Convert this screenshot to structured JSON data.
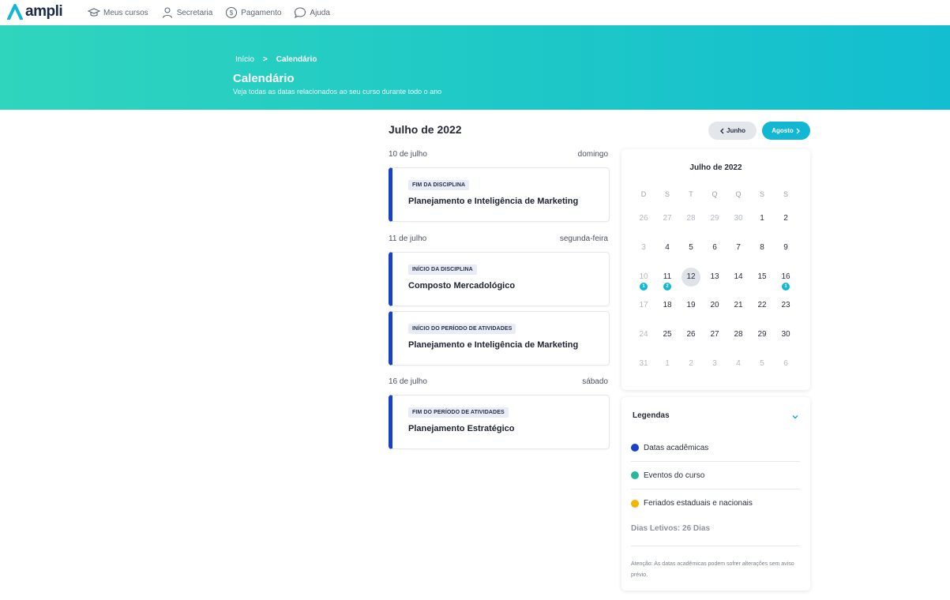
{
  "brand": {
    "name": "ampli",
    "color": "#12b7d3"
  },
  "nav": {
    "items": [
      {
        "label": "Meus cursos",
        "icon": "graduation-cap-icon"
      },
      {
        "label": "Secretaria",
        "icon": "user-icon"
      },
      {
        "label": "Pagamento",
        "icon": "dollar-circle-icon"
      },
      {
        "label": "Ajuda",
        "icon": "chat-bubble-icon"
      }
    ]
  },
  "breadcrumb": {
    "home": "Início",
    "separator": ">",
    "current": "Calendário"
  },
  "hero": {
    "title": "Calendário",
    "subtitle": "Veja todas as datas relacionados ao seu curso durante todo o ano"
  },
  "month": {
    "title": "Julho de 2022",
    "prev_label": "Junho",
    "next_label": "Agosto"
  },
  "days": [
    {
      "date": "10 de julho",
      "weekday": "domingo",
      "events": [
        {
          "tag": "FIM DA DISCIPLINA",
          "name": "Planejamento e Inteligência de Marketing"
        }
      ]
    },
    {
      "date": "11 de julho",
      "weekday": "segunda-feira",
      "events": [
        {
          "tag": "INÍCIO DA DISCIPLINA",
          "name": "Composto Mercadológico"
        },
        {
          "tag": "INÍCIO DO PERÍODO DE ATIVIDADES",
          "name": "Planejamento e Inteligência de Marketing"
        }
      ]
    },
    {
      "date": "16 de julho",
      "weekday": "sábado",
      "events": [
        {
          "tag": "FIM DO PERÍODO DE ATIVIDADES",
          "name": "Planejamento Estratégico"
        }
      ]
    }
  ],
  "calendar": {
    "title": "Julho de 2022",
    "weekdays": [
      "D",
      "S",
      "T",
      "Q",
      "Q",
      "S",
      "S"
    ],
    "weeks": [
      [
        {
          "d": "26",
          "muted": true
        },
        {
          "d": "27",
          "muted": true
        },
        {
          "d": "28",
          "muted": true
        },
        {
          "d": "29",
          "muted": true
        },
        {
          "d": "30",
          "muted": true
        },
        {
          "d": "1"
        },
        {
          "d": "2"
        }
      ],
      [
        {
          "d": "3",
          "muted": true
        },
        {
          "d": "4"
        },
        {
          "d": "5"
        },
        {
          "d": "6"
        },
        {
          "d": "7"
        },
        {
          "d": "8"
        },
        {
          "d": "9"
        }
      ],
      [
        {
          "d": "10",
          "muted": true,
          "badge": "1"
        },
        {
          "d": "11",
          "badge": "2"
        },
        {
          "d": "12",
          "today": true
        },
        {
          "d": "13"
        },
        {
          "d": "14"
        },
        {
          "d": "15"
        },
        {
          "d": "16",
          "badge": "1"
        }
      ],
      [
        {
          "d": "17",
          "muted": true
        },
        {
          "d": "18"
        },
        {
          "d": "19"
        },
        {
          "d": "20"
        },
        {
          "d": "21"
        },
        {
          "d": "22"
        },
        {
          "d": "23"
        }
      ],
      [
        {
          "d": "24",
          "muted": true
        },
        {
          "d": "25"
        },
        {
          "d": "26"
        },
        {
          "d": "27"
        },
        {
          "d": "28"
        },
        {
          "d": "29"
        },
        {
          "d": "30"
        }
      ],
      [
        {
          "d": "31",
          "muted": true
        },
        {
          "d": "1",
          "muted": true
        },
        {
          "d": "2",
          "muted": true
        },
        {
          "d": "3",
          "muted": true
        },
        {
          "d": "4",
          "muted": true
        },
        {
          "d": "5",
          "muted": true
        },
        {
          "d": "6",
          "muted": true
        }
      ]
    ]
  },
  "legend": {
    "title": "Legendas",
    "items": [
      {
        "label": "Datas acadêmicas",
        "color": "#1741c8"
      },
      {
        "label": "Eventos do curso",
        "color": "#25b89c"
      },
      {
        "label": "Feriados estaduais e nacionais",
        "color": "#f5b400"
      }
    ],
    "school_days": "Dias Letivos: 26 Dias",
    "note": "Atenção: As datas acadêmicas podem sofrer alterações sem aviso prévio."
  }
}
